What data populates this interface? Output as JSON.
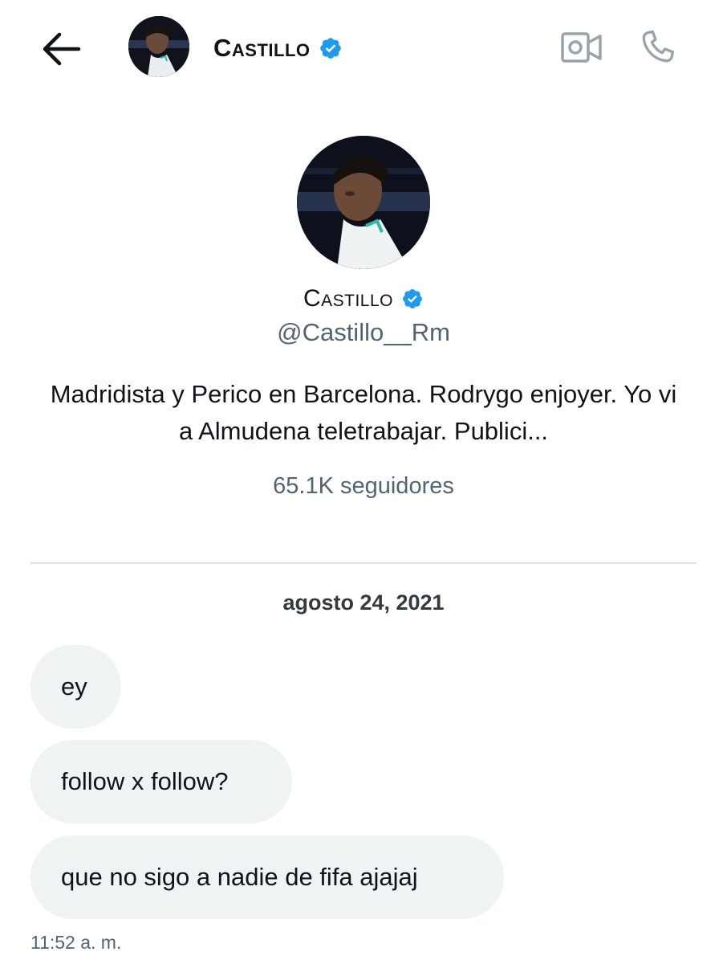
{
  "header": {
    "name": "Castillo",
    "icons": {
      "back": "arrow-left-icon",
      "video": "video-camera-icon",
      "call": "phone-icon",
      "verified": "verified-badge-icon"
    }
  },
  "profile": {
    "name": "Castillo",
    "handle": "@Castillo__Rm",
    "bio": "Madridista y Perico en Barcelona. Rodrygo enjoyer. Yo vi a Almudena teletrabajar. Publici...",
    "followers": "65.1K seguidores"
  },
  "conversation": {
    "date": "agosto 24, 2021",
    "messages": [
      {
        "text": "ey"
      },
      {
        "text": "follow x follow?"
      },
      {
        "text": "que no sigo a nadie de fifa ajajaj"
      }
    ],
    "last_time": "11:52 a. m."
  },
  "colors": {
    "verified": "#1d9bf0",
    "bubble": "#eff3f4",
    "secondary_text": "#536471",
    "primary_text": "#0f1419"
  }
}
